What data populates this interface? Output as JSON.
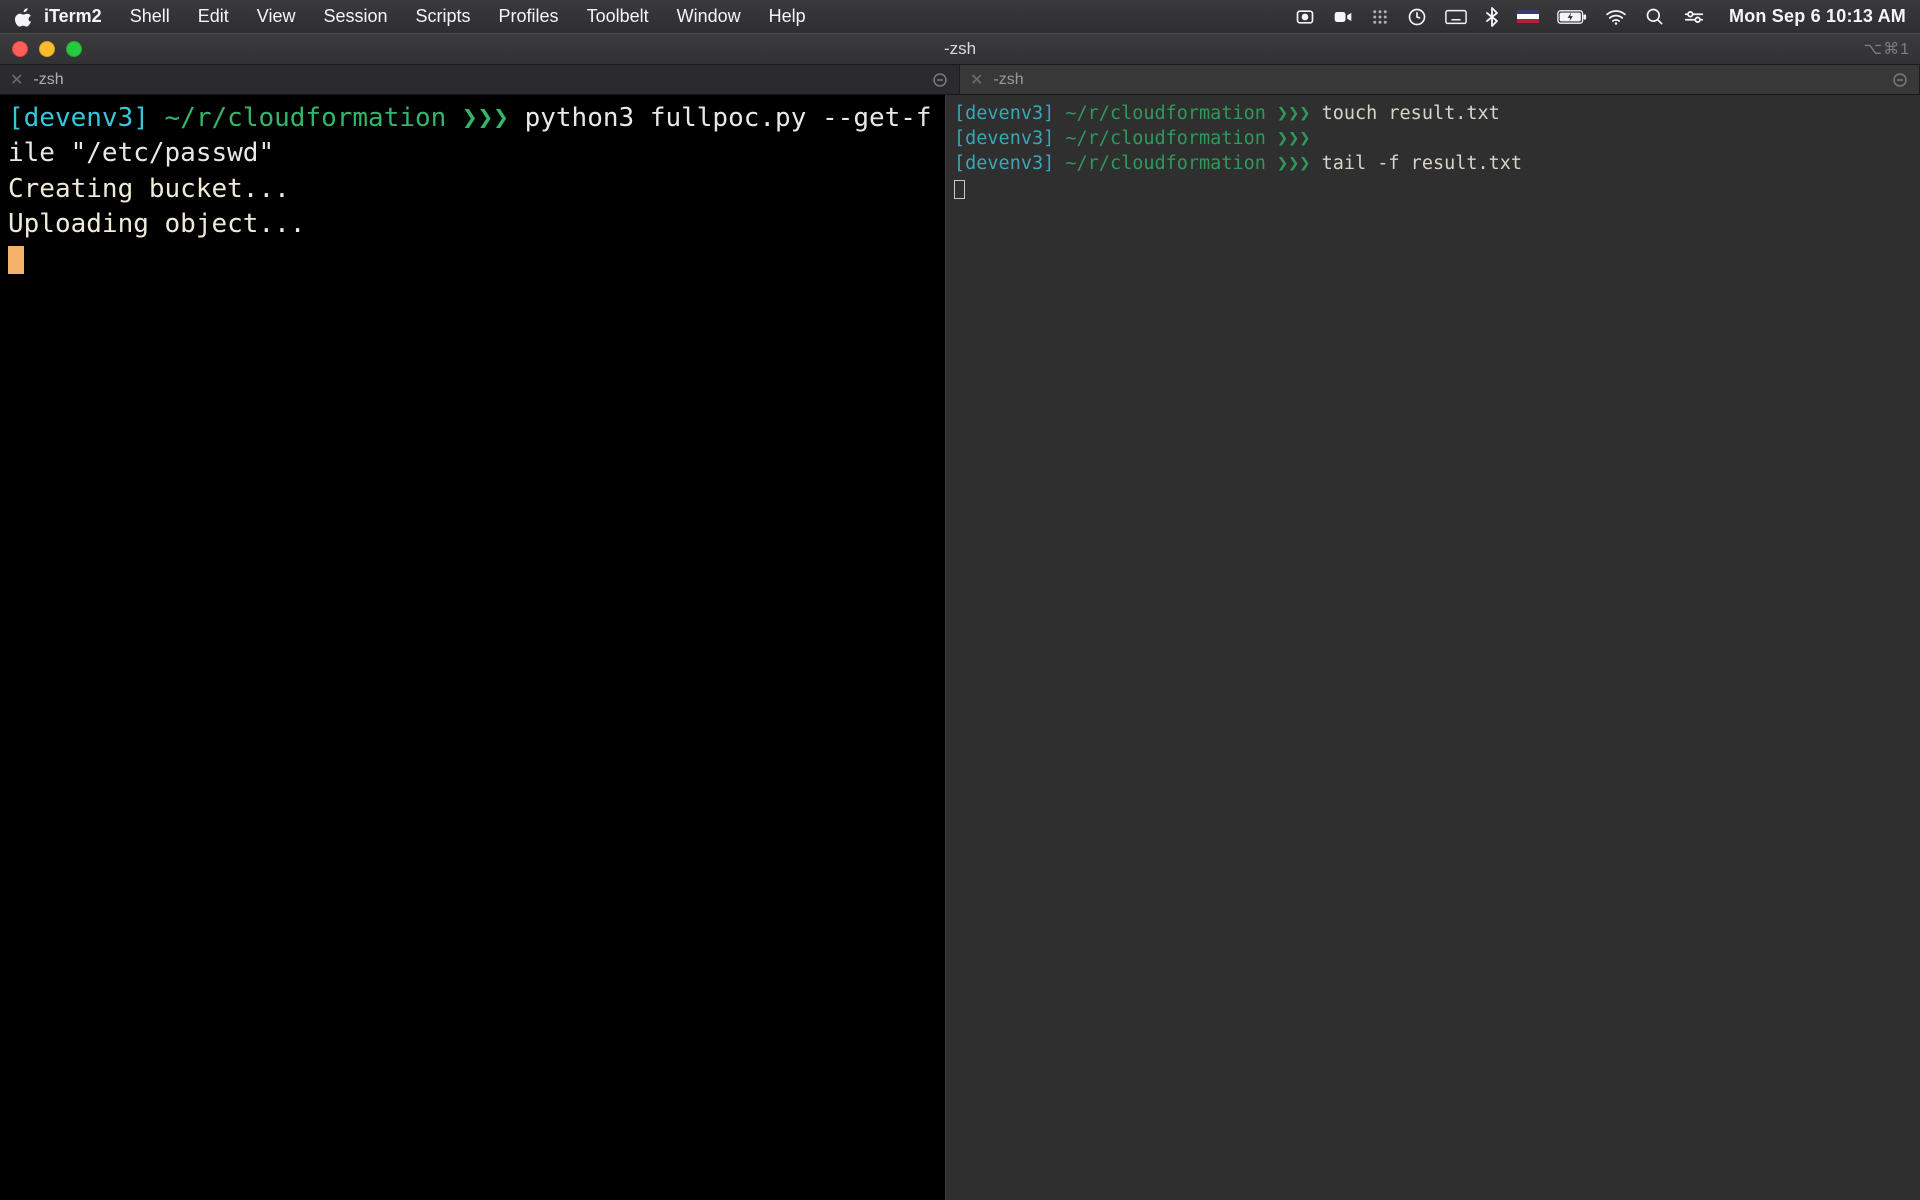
{
  "menubar": {
    "app_name": "iTerm2",
    "menus": [
      "Shell",
      "Edit",
      "View",
      "Session",
      "Scripts",
      "Profiles",
      "Toolbelt",
      "Window",
      "Help"
    ],
    "clock": "Mon Sep 6  10:13 AM",
    "tray_icons": [
      "screen-record-icon",
      "facetime-icon",
      "grid-icon",
      "piezo-icon",
      "keys-icon",
      "bluetooth-icon",
      "input-flag-us",
      "battery-icon",
      "wifi-icon",
      "spotlight-icon",
      "control-center-icon"
    ]
  },
  "window": {
    "title": "-zsh",
    "right_indicator": "⌥⌘1"
  },
  "tabs": [
    {
      "label": "-zsh",
      "active": true
    },
    {
      "label": "-zsh",
      "active": false
    }
  ],
  "left_pane": {
    "prompt_env": "[devenv3]",
    "prompt_path": "~/r/cloudformation",
    "prompt_arrows": "❯❯❯",
    "command": "python3 fullpoc.py --get-file \"/etc/passwd\"",
    "output": [
      "Creating bucket...",
      "Uploading object..."
    ]
  },
  "right_pane": {
    "lines": [
      {
        "env": "[devenv3]",
        "path": "~/r/cloudformation",
        "arrows": "❯❯❯",
        "cmd": "touch result.txt"
      },
      {
        "env": "[devenv3]",
        "path": "~/r/cloudformation",
        "arrows": "❯❯❯",
        "cmd": ""
      },
      {
        "env": "[devenv3]",
        "path": "~/r/cloudformation",
        "arrows": "❯❯❯",
        "cmd": "tail -f result.txt"
      }
    ]
  },
  "colors": {
    "bg_black": "#000000",
    "bg_gray": "#2f2f2f",
    "env": "#39c6d9",
    "path": "#33b56a",
    "cursor": "#f6b26b"
  }
}
